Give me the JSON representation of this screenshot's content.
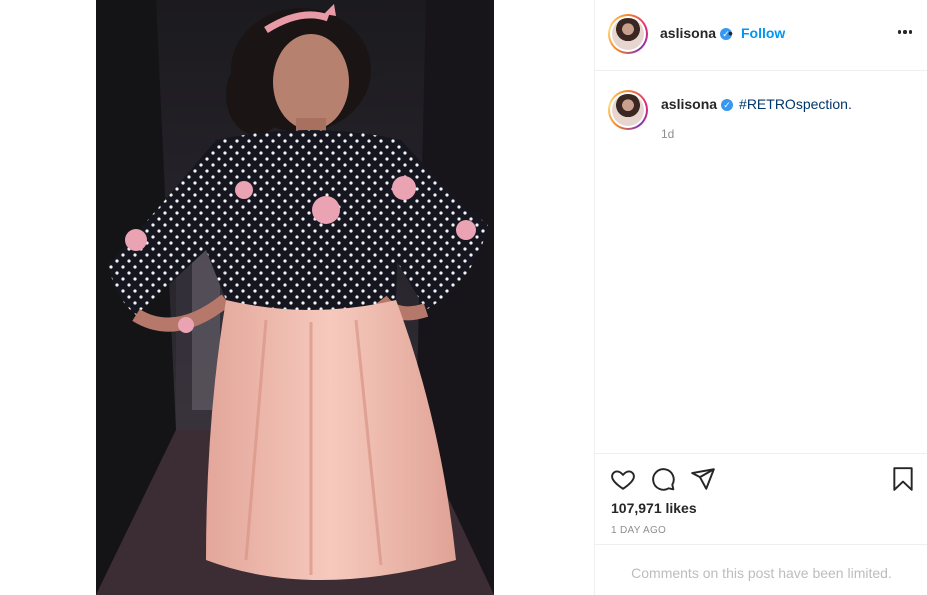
{
  "post": {
    "username": "aslisona",
    "verified_mark": "✓",
    "separator": "•",
    "follow_label": "Follow",
    "caption_hashtag": "#RETROspection.",
    "time_ago": "1d",
    "likes": "107,971 likes",
    "date": "1 DAY AGO",
    "comments_notice": "Comments on this post have been limited."
  },
  "icons": {
    "more": "more-options-icon",
    "like": "heart-icon",
    "comment": "comment-icon",
    "share": "send-icon",
    "save": "bookmark-icon"
  },
  "colors": {
    "follow": "#0095f6",
    "hashtag": "#00376b",
    "verified": "#3897f0",
    "muted": "#8e8e8e"
  }
}
